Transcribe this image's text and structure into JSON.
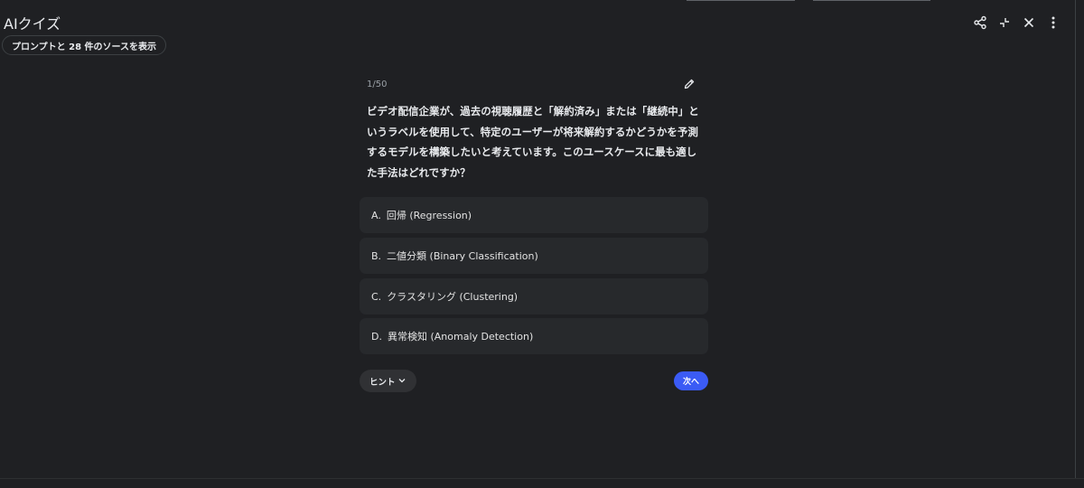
{
  "header": {
    "title": "AIクイズ",
    "source_chip_label": "プロンプトと 28 件のソースを表示",
    "icons": [
      "share-icon",
      "collapse-icon",
      "close-icon",
      "more-vert-icon"
    ]
  },
  "quiz": {
    "counter": "1/50",
    "question": "ビデオ配信企業が、過去の視聴履歴と「解約済み」または「継続中」というラベルを使用して、特定のユーザーが将来解約するかどうかを予測するモデルを構築したいと考えています。このユースケースに最も適した手法はどれですか？",
    "options": [
      {
        "letter": "A.",
        "text": "回帰 (Regression)"
      },
      {
        "letter": "B.",
        "text": "二値分類 (Binary Classification)"
      },
      {
        "letter": "C.",
        "text": "クラスタリング (Clustering)"
      },
      {
        "letter": "D.",
        "text": "異常検知 (Anomaly Detection)"
      }
    ],
    "hint_label": "ヒント",
    "next_label": "次へ"
  },
  "colors": {
    "background": "#1f2023",
    "option_bg": "#27292c",
    "accent": "#3b5bf5"
  }
}
